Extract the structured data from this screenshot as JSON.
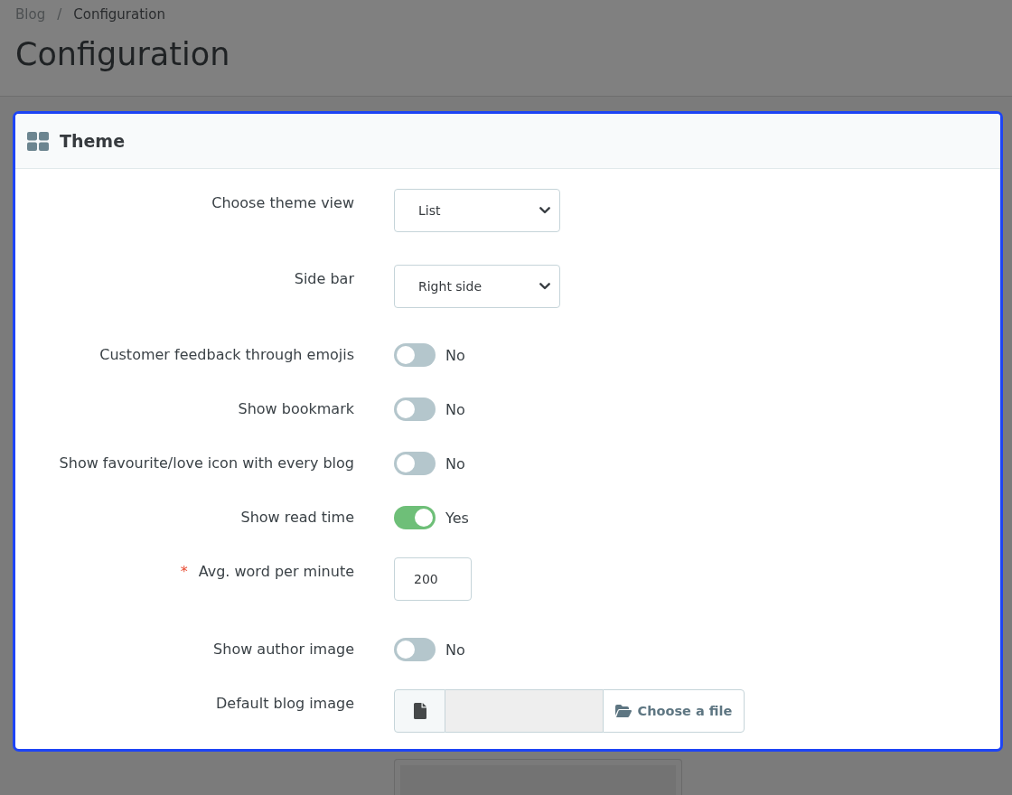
{
  "breadcrumb": {
    "items": [
      {
        "label": "Blog",
        "current": false
      },
      {
        "label": "Configuration",
        "current": true
      }
    ],
    "separator": "/"
  },
  "page_title": "Configuration",
  "panel": {
    "title": "Theme",
    "fields": [
      {
        "kind": "select",
        "label": "Choose theme view",
        "value": "List"
      },
      {
        "kind": "select",
        "label": "Side bar",
        "value": "Right side"
      },
      {
        "kind": "toggle",
        "label": "Customer feedback through emojis",
        "on": false,
        "state_text": "No"
      },
      {
        "kind": "toggle",
        "label": "Show bookmark",
        "on": false,
        "state_text": "No"
      },
      {
        "kind": "toggle",
        "label": "Show favourite/love icon with every blog",
        "on": false,
        "state_text": "No"
      },
      {
        "kind": "toggle",
        "label": "Show read time",
        "on": true,
        "state_text": "Yes"
      },
      {
        "kind": "number",
        "label": "Avg. word per minute",
        "value": "200",
        "required_mark": "*"
      },
      {
        "kind": "toggle",
        "label": "Show author image",
        "on": false,
        "state_text": "No"
      },
      {
        "kind": "file",
        "label": "Default blog image",
        "button": "Choose a file"
      }
    ]
  }
}
